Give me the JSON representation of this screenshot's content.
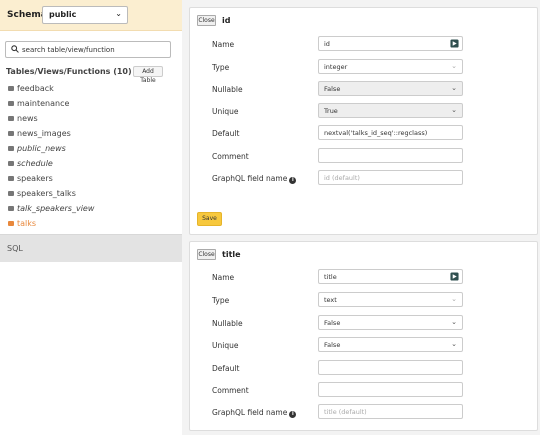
{
  "sidebar": {
    "schema_label": "Schema:",
    "schema_value": "public",
    "search_placeholder": "search table/view/function",
    "tables_title": "Tables/Views/Functions (10)",
    "add_table_label": "Add Table",
    "items": [
      {
        "label": "feedback",
        "kind": "table"
      },
      {
        "label": "maintenance",
        "kind": "table"
      },
      {
        "label": "news",
        "kind": "table"
      },
      {
        "label": "news_images",
        "kind": "table"
      },
      {
        "label": "public_news",
        "kind": "view"
      },
      {
        "label": "schedule",
        "kind": "view"
      },
      {
        "label": "speakers",
        "kind": "table"
      },
      {
        "label": "speakers_talks",
        "kind": "table"
      },
      {
        "label": "talk_speakers_view",
        "kind": "view"
      },
      {
        "label": "talks",
        "kind": "table",
        "active": true
      }
    ],
    "sql_label": "SQL"
  },
  "columns": [
    {
      "close_label": "Close",
      "name": "id",
      "labels": {
        "name": "Name",
        "type": "Type",
        "nullable": "Nullable",
        "unique": "Unique",
        "default": "Default",
        "comment": "Comment",
        "graphql": "GraphQL field name"
      },
      "values": {
        "name": "id",
        "type": "integer",
        "nullable": "False",
        "unique": "True",
        "default": "nextval('talks_id_seq'::regclass)",
        "comment": "",
        "graphql": "id (default)"
      },
      "save_label": "Save"
    },
    {
      "close_label": "Close",
      "name": "title",
      "labels": {
        "name": "Name",
        "type": "Type",
        "nullable": "Nullable",
        "unique": "Unique",
        "default": "Default",
        "comment": "Comment",
        "graphql": "GraphQL field name"
      },
      "values": {
        "name": "title",
        "type": "text",
        "nullable": "False",
        "unique": "False",
        "default": "",
        "comment": "",
        "graphql": "title (default)"
      }
    }
  ],
  "icons": {
    "search": "search-icon",
    "table": "table-icon",
    "info": "info-icon",
    "graphql_badge": "graphql-icon",
    "chevron": "chevron-down-icon"
  },
  "colors": {
    "schema_bar": "#fbeed0",
    "active_item": "#e8883c",
    "save_button": "#f7c83d"
  }
}
